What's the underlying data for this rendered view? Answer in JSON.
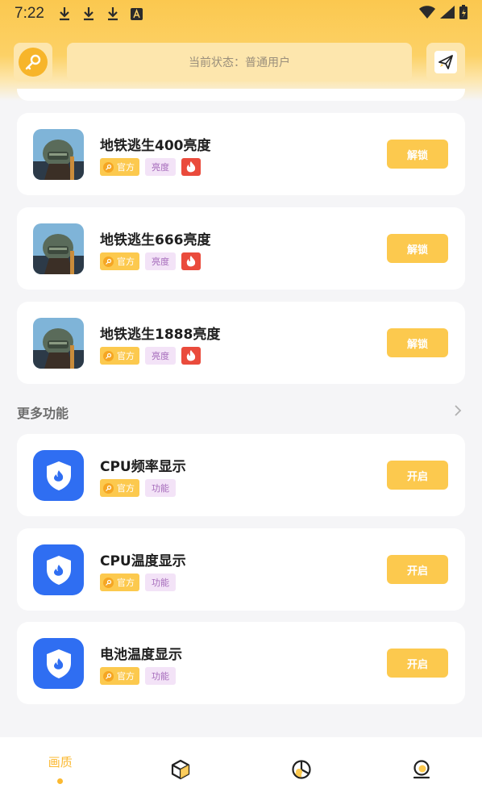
{
  "status_bar": {
    "time": "7:22"
  },
  "header": {
    "status_text": "当前状态：普通用户"
  },
  "cards": [
    {
      "title": "地铁逃生400亮度",
      "official": "官方",
      "category": "亮度",
      "hot": true,
      "action": "解锁",
      "thumb": "pubg-icon"
    },
    {
      "title": "地铁逃生666亮度",
      "official": "官方",
      "category": "亮度",
      "hot": true,
      "action": "解锁",
      "thumb": "pubg-icon"
    },
    {
      "title": "地铁逃生1888亮度",
      "official": "官方",
      "category": "亮度",
      "hot": true,
      "action": "解锁",
      "thumb": "pubg-icon"
    }
  ],
  "more_section": {
    "title": "更多功能"
  },
  "features": [
    {
      "title": "CPU频率显示",
      "official": "官方",
      "category": "功能",
      "action": "开启",
      "thumb": "shield-icon"
    },
    {
      "title": "CPU温度显示",
      "official": "官方",
      "category": "功能",
      "action": "开启",
      "thumb": "shield-icon"
    },
    {
      "title": "电池温度显示",
      "official": "官方",
      "category": "功能",
      "action": "开启",
      "thumb": "shield-icon"
    }
  ],
  "bottom_nav": [
    {
      "label": "画质",
      "icon": "image-quality-icon",
      "active": true
    },
    {
      "label": "",
      "icon": "cube-icon",
      "active": false
    },
    {
      "label": "",
      "icon": "pie-chart-icon",
      "active": false
    },
    {
      "label": "",
      "icon": "profile-icon",
      "active": false
    }
  ],
  "colors": {
    "accent": "#fcc94e",
    "shield_blue": "#2f6ef2",
    "fire_red": "#ea4b3c"
  }
}
